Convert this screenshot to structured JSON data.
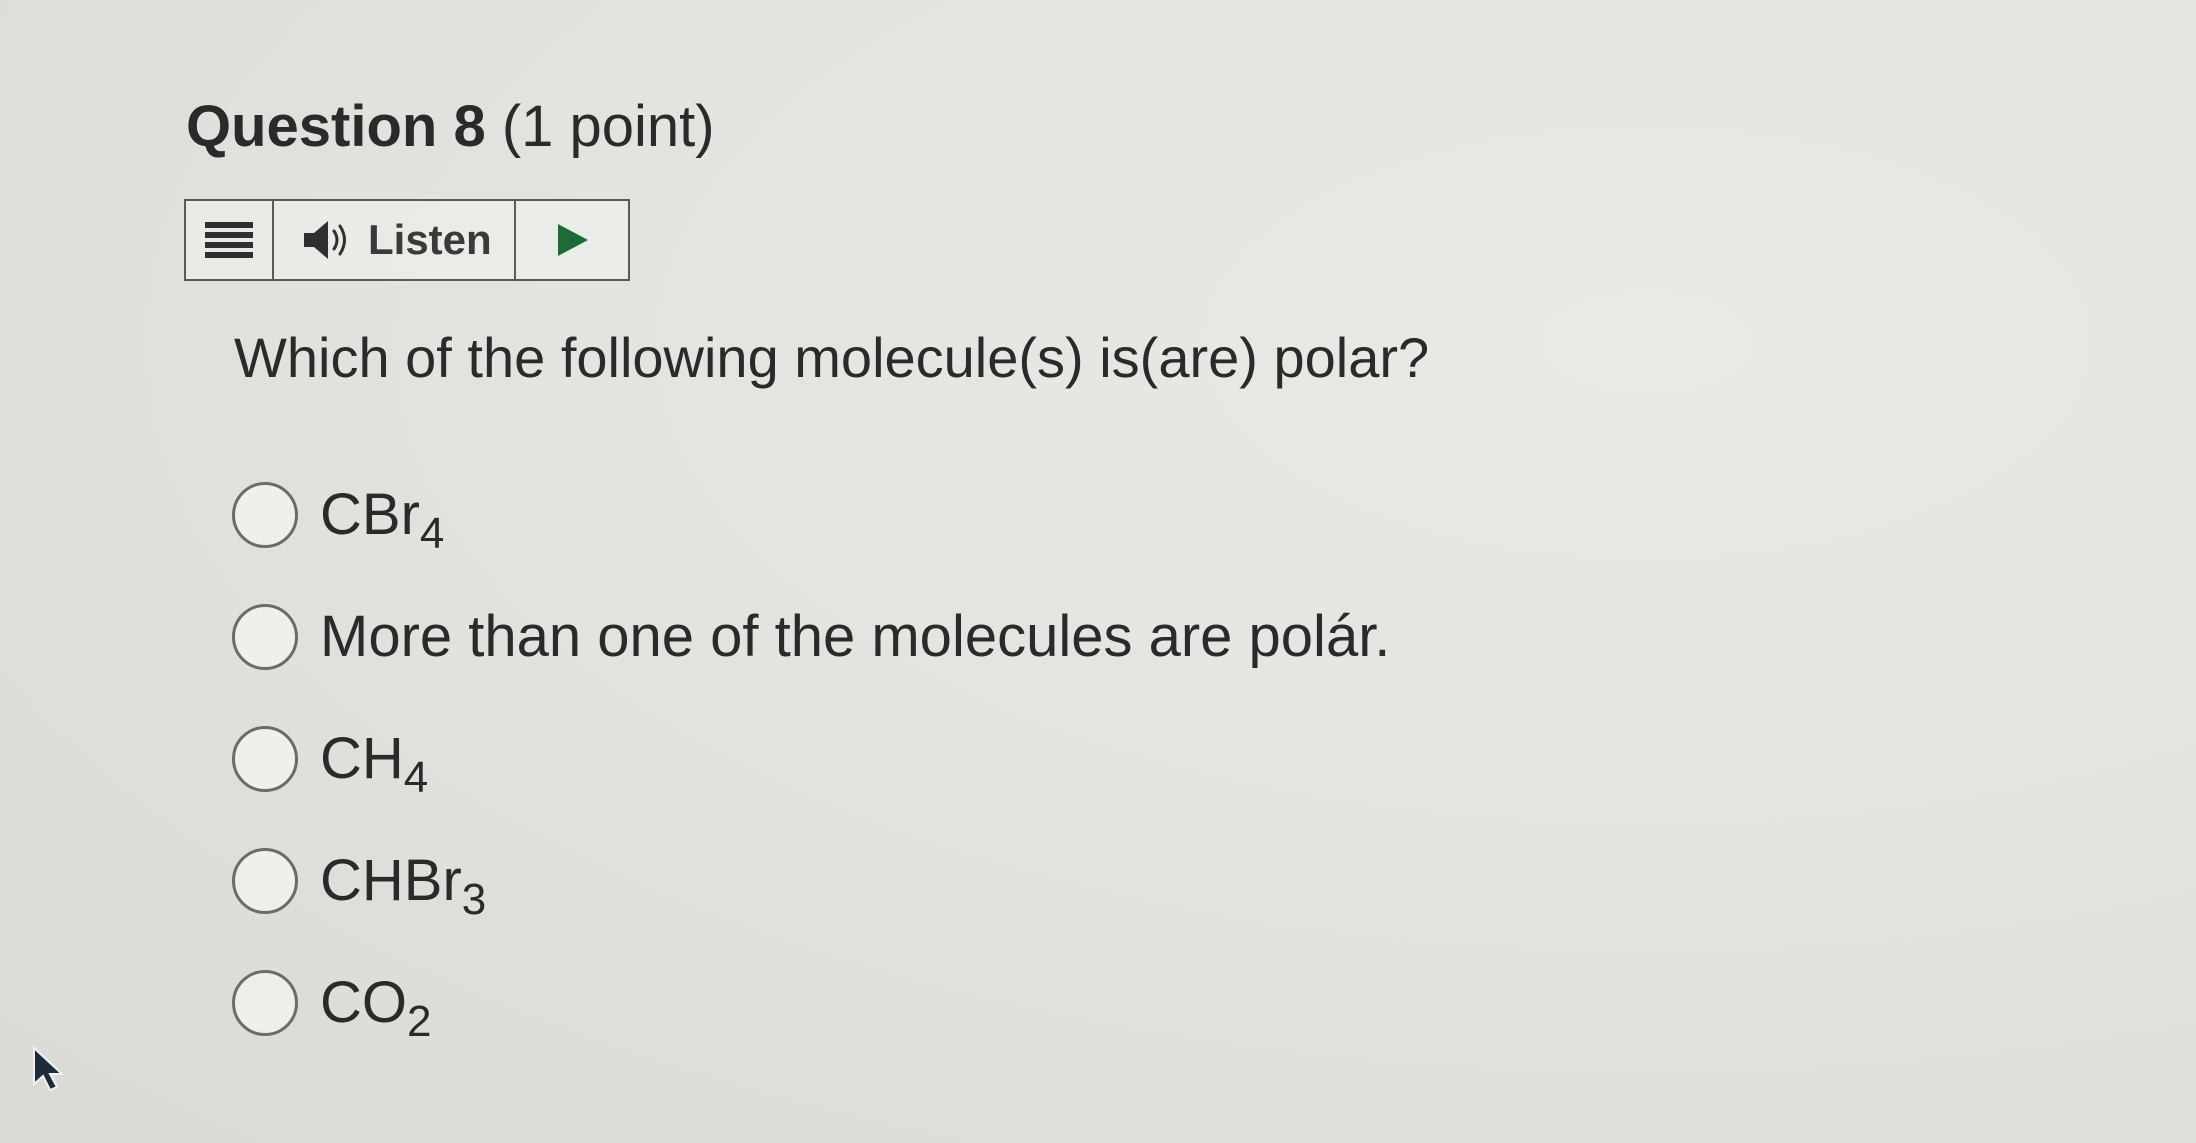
{
  "question": {
    "number_label": "Question 8",
    "points_label": "(1 point)",
    "prompt": "Which of the following molecule(s) is(are) polar?"
  },
  "listen_bar": {
    "menu_icon": "hamburger-icon",
    "speaker_icon": "speaker-icon",
    "listen_label": "Listen",
    "play_icon": "play-icon",
    "play_color": "#1e6b3a"
  },
  "options": [
    {
      "base": "CBr",
      "subscript": "4"
    },
    {
      "base": "More than one of the molecules are polár.",
      "subscript": ""
    },
    {
      "base": "CH",
      "subscript": "4"
    },
    {
      "base": "CHBr",
      "subscript": "3"
    },
    {
      "base": "CO",
      "subscript": "2"
    }
  ]
}
